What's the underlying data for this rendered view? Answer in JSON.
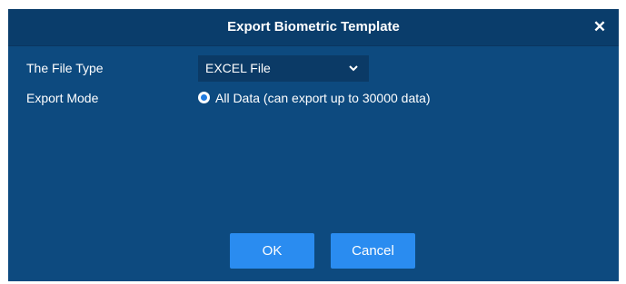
{
  "dialog": {
    "title": "Export Biometric Template",
    "close_icon": "close-icon"
  },
  "form": {
    "file_type_label": "The File Type",
    "file_type_value": "EXCEL File",
    "export_mode_label": "Export Mode",
    "export_mode_option": "All Data (can export up to 30000 data)",
    "export_mode_selected": true
  },
  "buttons": {
    "ok": "OK",
    "cancel": "Cancel"
  },
  "colors": {
    "dialog_bg": "#0d4a7f",
    "titlebar_bg": "#0a3d6b",
    "button_bg": "#2a8cf0",
    "radio_accent": "#1f7be0"
  }
}
